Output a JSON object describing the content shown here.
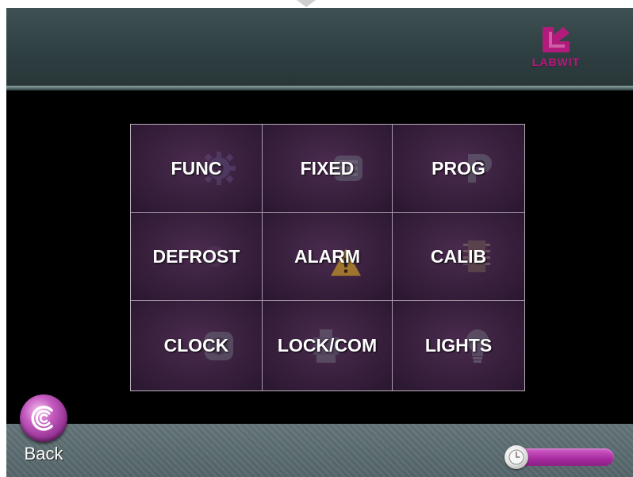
{
  "header": {
    "logo_text": "LABWIT",
    "accent_color": "#b21b7c"
  },
  "menu": {
    "items": [
      {
        "label": "FUNC",
        "icon": "gear-icon"
      },
      {
        "label": "FIXED",
        "icon": "fixed-program-icon"
      },
      {
        "label": "PROG",
        "icon": "p-program-icon"
      },
      {
        "label": "DEFROST",
        "icon": "defrost-icon"
      },
      {
        "label": "ALARM",
        "icon": "warning-triangle-icon"
      },
      {
        "label": "CALIB",
        "icon": "calibration-chip-icon"
      },
      {
        "label": "CLOCK",
        "icon": "clock-icon"
      },
      {
        "label": "LOCK/COM",
        "icon": "lock-com-icon"
      },
      {
        "label": "LIGHTS",
        "icon": "bulb-icon"
      }
    ]
  },
  "footer": {
    "back_label": "Back",
    "back_icon": "back-swirl-icon",
    "status_icon": "clock-icon"
  }
}
